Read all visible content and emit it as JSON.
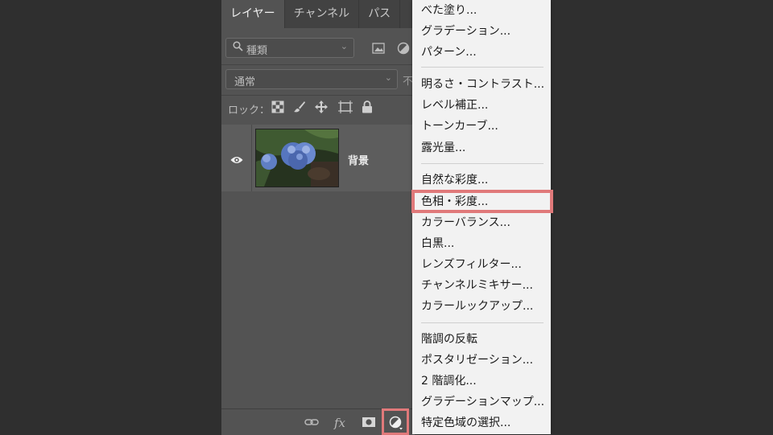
{
  "layers_panel": {
    "tabs": [
      {
        "label": "レイヤー",
        "active": true
      },
      {
        "label": "チャンネル",
        "active": false
      },
      {
        "label": "パス",
        "active": false
      }
    ],
    "filter": {
      "kind_label": "種類"
    },
    "blend_mode": "通常",
    "opacity_label": "不",
    "lock_label": "ロック：",
    "layers": [
      {
        "name": "背景",
        "visible": true
      }
    ],
    "bottom_icons": [
      "link-icon",
      "fx-icon",
      "mask-icon",
      "adjustment-layer-icon"
    ],
    "fx_label": "fx"
  },
  "adjustment_menu": {
    "groups": [
      [
        "べた塗り...",
        "グラデーション...",
        "パターン..."
      ],
      [
        "明るさ・コントラスト...",
        "レベル補正...",
        "トーンカーブ...",
        "露光量..."
      ],
      [
        "自然な彩度...",
        "色相・彩度...",
        "カラーバランス...",
        "白黒...",
        "レンズフィルター...",
        "チャンネルミキサー...",
        "カラールックアップ..."
      ],
      [
        "階調の反転",
        "ポスタリゼーション...",
        "2 階調化...",
        "グラデーションマップ...",
        "特定色域の選択..."
      ]
    ],
    "highlighted_item": "色相・彩度..."
  },
  "colors": {
    "highlight": "#e0797a",
    "panel_bg": "#535353",
    "menu_bg": "#f2f2f2"
  }
}
